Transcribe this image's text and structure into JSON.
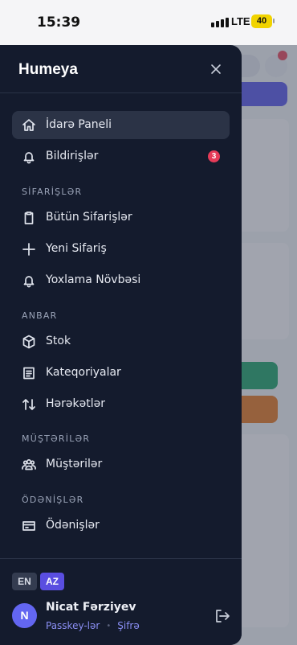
{
  "status_bar": {
    "time": "15:39",
    "network": "LTE",
    "battery": "40"
  },
  "drawer": {
    "brand": "Humeya",
    "items": [
      {
        "label": "İdarə Paneli",
        "icon": "home-icon",
        "active": true
      },
      {
        "label": "Bildirişlər",
        "icon": "bell-icon",
        "badge": "3"
      }
    ],
    "sections": [
      {
        "title": "SİFARİŞLƏR",
        "items": [
          {
            "label": "Bütün Sifarişlər",
            "icon": "clipboard-icon"
          },
          {
            "label": "Yeni Sifariş",
            "icon": "plus-icon"
          },
          {
            "label": "Yoxlama Növbəsi",
            "icon": "bell-icon"
          }
        ]
      },
      {
        "title": "ANBAR",
        "items": [
          {
            "label": "Stok",
            "icon": "box-icon"
          },
          {
            "label": "Kateqoriyalar",
            "icon": "list-icon"
          },
          {
            "label": "Hərəkətlər",
            "icon": "arrows-up-down-icon"
          }
        ]
      },
      {
        "title": "MÜŞTƏRİLƏR",
        "items": [
          {
            "label": "Müştərilər",
            "icon": "users-icon"
          }
        ]
      },
      {
        "title": "ÖDƏNİŞLƏR",
        "items": [
          {
            "label": "Ödənişlər",
            "icon": "card-icon"
          }
        ]
      }
    ]
  },
  "footer": {
    "languages": [
      "EN",
      "AZ"
    ],
    "active_language": "AZ",
    "user": {
      "initial": "N",
      "name": "Nicat Fərziyev",
      "link_passkeys": "Passkey-lər",
      "link_password": "Şifrə"
    }
  },
  "colors": {
    "drawer_bg": "#141b2d",
    "accent": "#5a4ee0",
    "badge": "#e63b58"
  }
}
